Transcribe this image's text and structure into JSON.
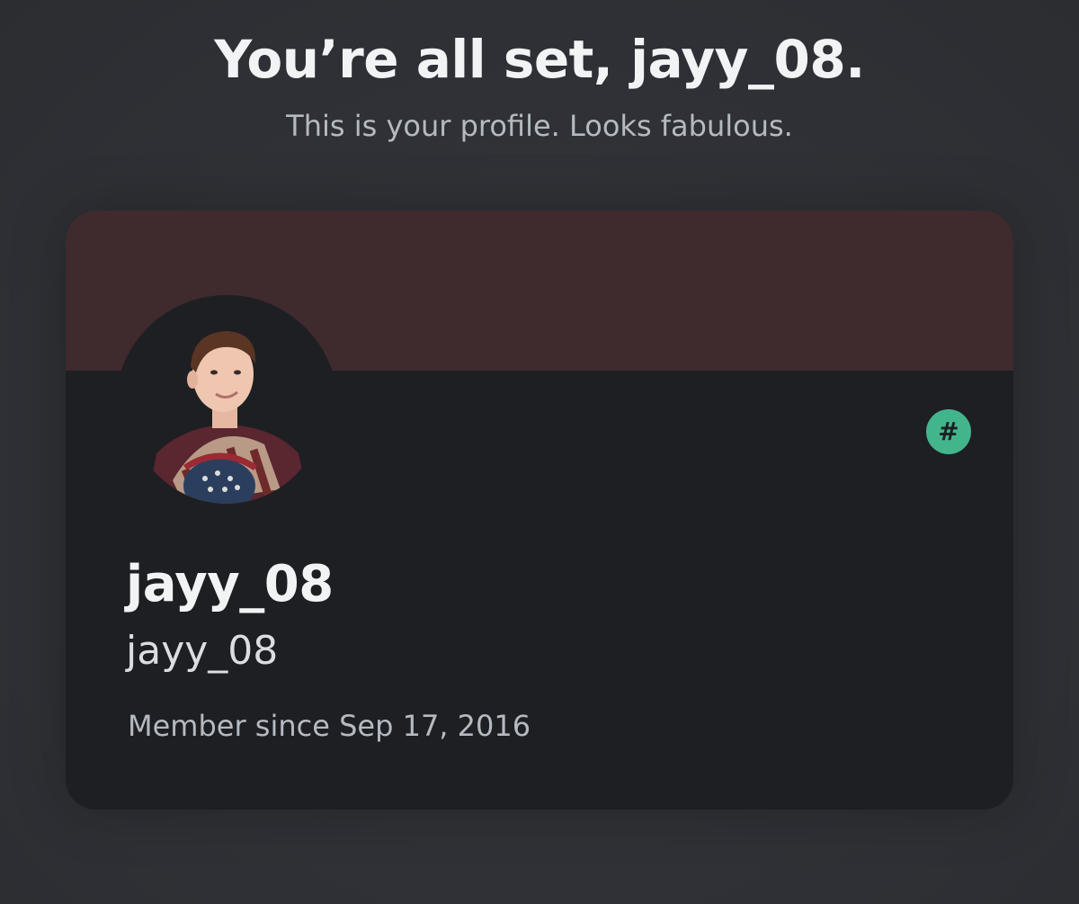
{
  "header": {
    "title": "You’re all set, jayy_08.",
    "subtitle": "This is your profile. Looks fabulous."
  },
  "profile": {
    "banner_color": "#3f2a2e",
    "avatar_icon": "user-avatar-photo",
    "badge": {
      "icon": "hashtag-icon",
      "glyph": "#",
      "color": "#43b58c"
    },
    "display_name": "jayy_08",
    "username": "jayy_08",
    "member_since": "Member since Sep 17, 2016"
  },
  "colors": {
    "page_background": "#313338",
    "card_background": "#1e1f22",
    "title_text": "#f2f3f5",
    "subtitle_text": "#b5bac1"
  }
}
